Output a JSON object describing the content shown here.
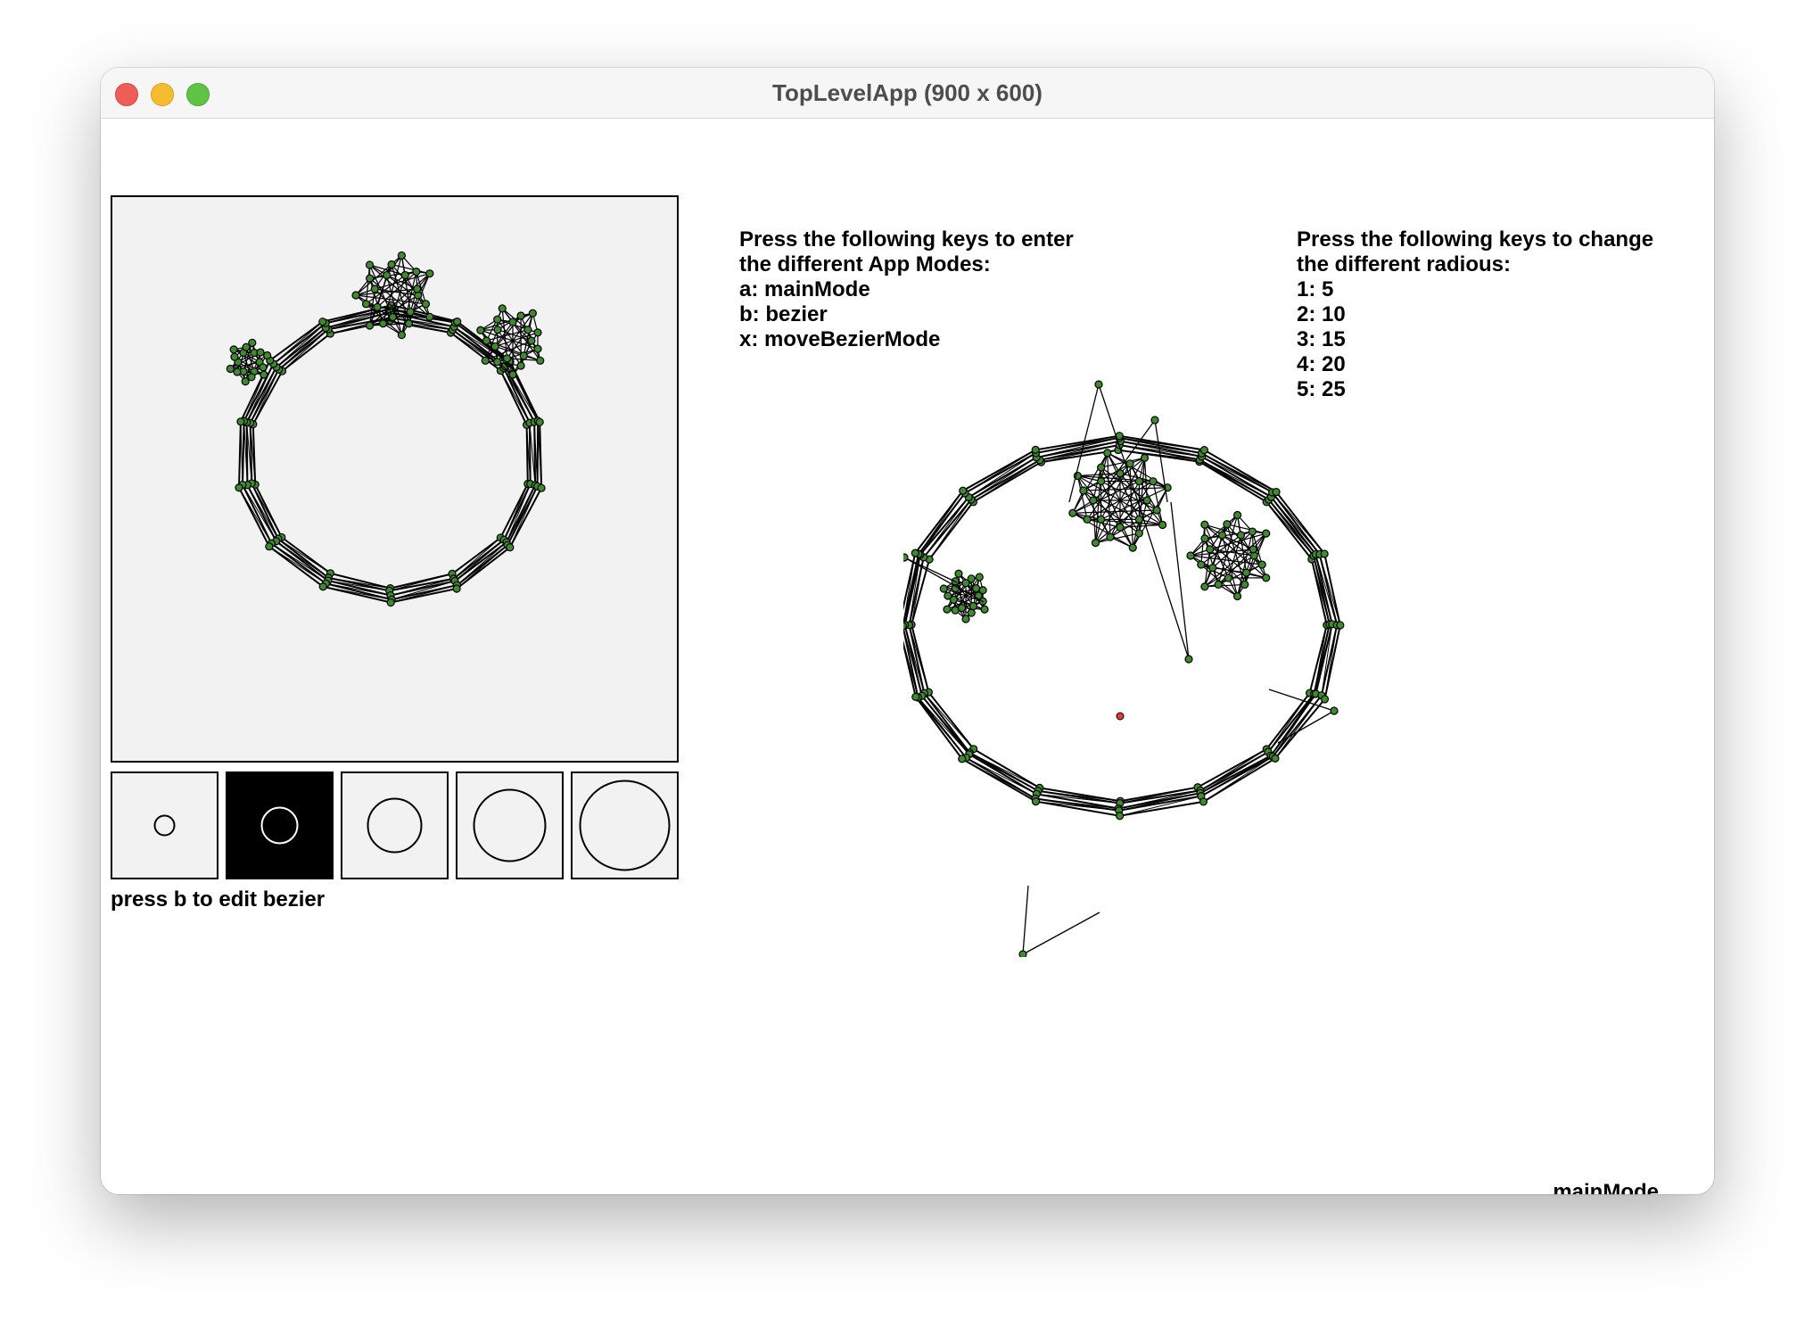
{
  "window": {
    "title": "TopLevelApp (900 x 600)"
  },
  "instructions": {
    "modes_heading_line1": "Press the following keys to enter",
    "modes_heading_line2": "the different App Modes:",
    "modes": [
      "a: mainMode",
      "b: bezier",
      "x: moveBezierMode"
    ],
    "radius_heading_line1": "Press the following keys to change",
    "radius_heading_line2": "the different radious:",
    "radii": [
      "1: 5",
      "2: 10",
      "3: 15",
      "4: 20",
      "5: 25"
    ]
  },
  "radius_buttons": {
    "selected_index": 1,
    "count": 5
  },
  "hint_text": "press b to edit bezier",
  "status_mode": "mainMode",
  "colors": {
    "node_fill": "#3f8a2e",
    "center_point": "#e53935",
    "preview_bg": "#f2f2f2"
  }
}
